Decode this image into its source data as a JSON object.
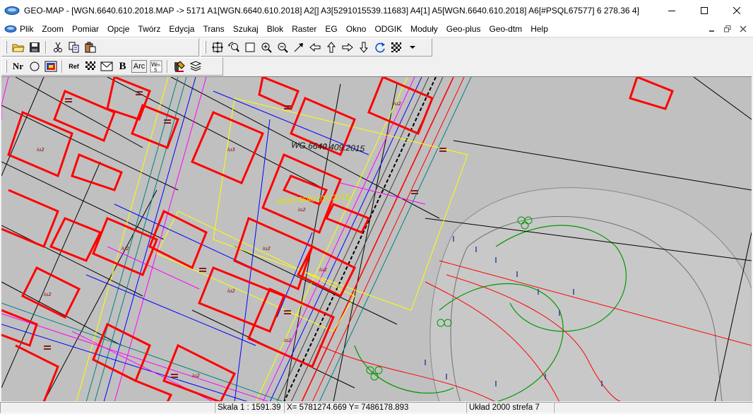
{
  "window": {
    "title": "GEO-MAP - [WGN.6640.610.2018.MAP -> 5171 A1[WGN.6640.610.2018]  A2[]  A3[5291015539.11683]  A4[1]  A5[WGN.6640.610.2018]  A6[#PSQL67577]  6      278.36      4]"
  },
  "menu": {
    "items": [
      "Plik",
      "Zoom",
      "Pomiar",
      "Opcje",
      "Twórz",
      "Edycja",
      "Trans",
      "Szukaj",
      "Blok",
      "Raster",
      "EG",
      "Okno",
      "ODGIK",
      "Moduły",
      "Geo-plus",
      "Geo-dtm",
      "Help"
    ]
  },
  "toolbar": {
    "nr_label": "Nr",
    "ref_label": "Ref",
    "bold_label": "B",
    "arc_label": "Arc",
    "icons": [
      "open-folder-icon",
      "save-icon",
      "cut-icon",
      "copy-icon",
      "paste-icon",
      "zoom-extent-icon",
      "zoom-back-icon",
      "zoom-window-icon",
      "zoom-in-icon",
      "zoom-out-icon",
      "pan-ne-icon",
      "pan-left-icon",
      "pan-up-icon",
      "pan-right-icon",
      "pan-down-icon",
      "redraw-icon",
      "pattern-icon",
      "dropdown-arrow-icon"
    ]
  },
  "map": {
    "labels": {
      "label1": "WG.6640.409.2015",
      "label2": "WGN.6640.610.2018"
    },
    "colors": {
      "background": "#c0c0c0",
      "buildings": "#ff0000",
      "parcels": "#000000",
      "utilities_blue": "#0000ff",
      "utilities_magenta": "#ff00ff",
      "greenery": "#009900",
      "yellow_boundary": "#ffff00",
      "teal": "#008080"
    }
  },
  "status": {
    "scale": "Skala 1 : 1591.39",
    "coords": "X=  5781274.669  Y=  7486178.893",
    "crs": "Układ 2000 strefa 7"
  }
}
